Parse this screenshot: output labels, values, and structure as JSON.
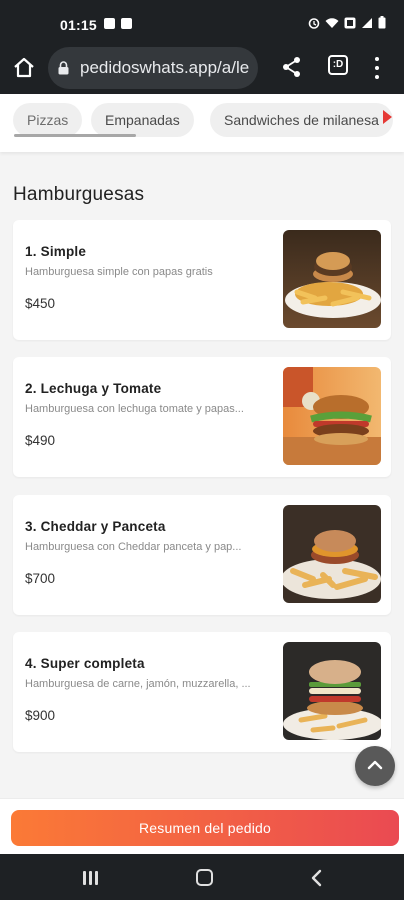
{
  "status_bar": {
    "time": "01:15"
  },
  "browser": {
    "url": "pedidoswhats.app/a/le",
    "tab_count": ":D"
  },
  "categories": [
    {
      "label": "Pizzas"
    },
    {
      "label": "Empanadas"
    },
    {
      "label": "Sandwiches de milanesa"
    }
  ],
  "section": {
    "title": "Hamburguesas"
  },
  "products": [
    {
      "name": "1. Simple",
      "description": "Hamburguesa simple con papas gratis",
      "price": "$450"
    },
    {
      "name": "2. Lechuga y Tomate",
      "description": "Hamburguesa con lechuga tomate y papas...",
      "price": "$490"
    },
    {
      "name": "3. Cheddar y Panceta",
      "description": "Hamburguesa con Cheddar panceta y pap...",
      "price": "$700"
    },
    {
      "name": "4. Super completa",
      "description": "Hamburguesa de carne, jamón, muzzarella, ...",
      "price": "$900"
    }
  ],
  "footer": {
    "summary_button": "Resumen del pedido"
  },
  "colors": {
    "accent_start": "#fb7a36",
    "accent_end": "#ea4a52",
    "scroll_arrow": "#e53935"
  },
  "icons": [
    "home-icon",
    "lock-icon",
    "share-icon",
    "tabs-icon",
    "more-vert-icon",
    "chevron-up-icon",
    "recents-icon",
    "nav-home-icon",
    "back-icon"
  ]
}
